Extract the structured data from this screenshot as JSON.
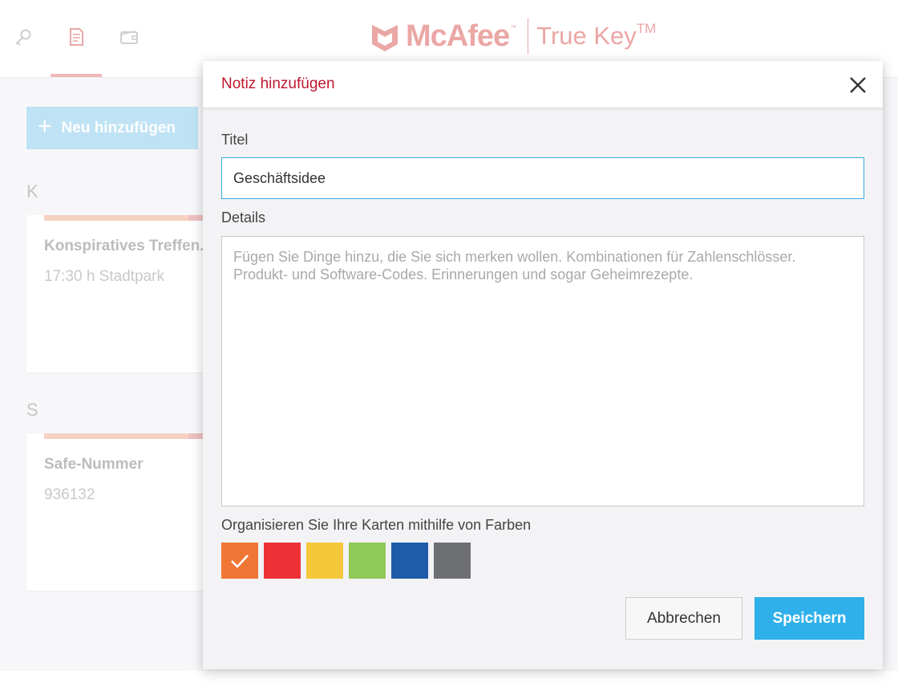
{
  "app": {
    "brand": "McAfee",
    "brand_tm": "™",
    "product": "True Key",
    "product_tm": "TM"
  },
  "nav": {
    "icons": [
      "key-icon",
      "note-icon",
      "wallet-icon"
    ],
    "active": "note-icon"
  },
  "background": {
    "add_button_label": "Neu hinzufügen",
    "sections": [
      {
        "letter": "K",
        "card": {
          "title": "Konspiratives Treffen.",
          "subtitle": "17:30 h Stadtpark"
        }
      },
      {
        "letter": "S",
        "card": {
          "title": "Safe-Nummer",
          "subtitle": "936132"
        }
      }
    ]
  },
  "modal": {
    "title": "Notiz hinzufügen",
    "title_label": "Titel",
    "title_value": "Geschäftsidee",
    "details_label": "Details",
    "details_placeholder": "Fügen Sie Dinge hinzu, die Sie sich merken wollen. Kombinationen für Zahlenschlösser. Produkt- und Software-Codes. Erinnerungen und sogar Geheimrezepte.",
    "colors_label": "Organisieren Sie Ihre Karten mithilfe von Farben",
    "colors": [
      "#ef7634",
      "#ee3136",
      "#f5c73a",
      "#8fc957",
      "#1f5ca8",
      "#6d6f73"
    ],
    "selected_color_index": 0,
    "cancel_label": "Abbrechen",
    "save_label": "Speichern"
  },
  "theme": {
    "accent_red": "#c0172f",
    "save_blue": "#2fb0ea",
    "input_focus": "#3aa9e2"
  }
}
